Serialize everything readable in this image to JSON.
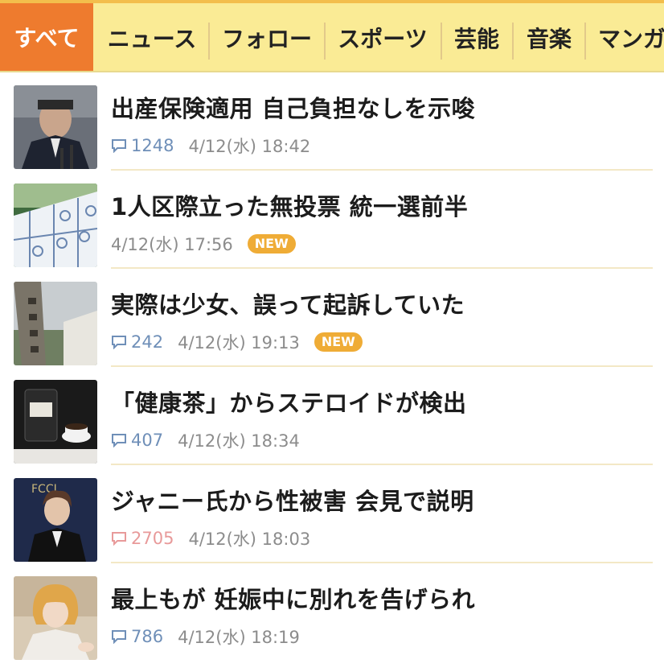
{
  "tabs": [
    {
      "label": "すべて",
      "active": true
    },
    {
      "label": "ニュース",
      "active": false
    },
    {
      "label": "フォロー",
      "active": false
    },
    {
      "label": "スポーツ",
      "active": false
    },
    {
      "label": "芸能",
      "active": false
    },
    {
      "label": "音楽",
      "active": false
    },
    {
      "label": "マンガ",
      "active": false
    }
  ],
  "articles": [
    {
      "title": "出産保険適用 自己負担なしを示唆",
      "comments": "1248",
      "date": "4/12(水) 18:42",
      "is_new": false,
      "hot": false,
      "thumb": "politician-photo"
    },
    {
      "title": "1人区際立った無投票 統一選前半",
      "comments": "",
      "date": "4/12(水) 17:56",
      "is_new": true,
      "hot": false,
      "thumb": "election-board-photo"
    },
    {
      "title": "実際は少女、誤って起訴していた",
      "comments": "242",
      "date": "4/12(水) 19:13",
      "is_new": true,
      "hot": false,
      "thumb": "prosecutor-office-photo"
    },
    {
      "title": "「健康茶」からステロイドが検出",
      "comments": "407",
      "date": "4/12(水) 18:34",
      "is_new": false,
      "hot": false,
      "thumb": "tea-product-photo"
    },
    {
      "title": "ジャニー氏から性被害 会見で説明",
      "comments": "2705",
      "date": "4/12(水) 18:03",
      "is_new": false,
      "hot": true,
      "thumb": "press-conference-photo"
    },
    {
      "title": "最上もが 妊娠中に別れを告げられ",
      "comments": "786",
      "date": "4/12(水) 18:19",
      "is_new": false,
      "hot": false,
      "thumb": "celebrity-photo"
    }
  ],
  "badge_label": "NEW",
  "colors": {
    "tabbar_bg": "#faeb95",
    "active_tab": "#ee7b2e",
    "new_badge": "#efac36",
    "comment_normal": "#6f8fb8",
    "comment_hot": "#e89a9a"
  }
}
